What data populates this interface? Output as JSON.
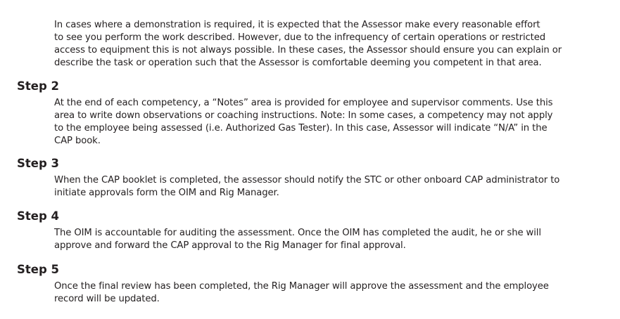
{
  "intro": {
    "lines": [
      "In cases where a demonstration is required, it is expected that the Assessor make every reasonable effort",
      "to see you perform the work described.  However, due to the infrequency of certain operations or restricted",
      "access to equipment this is not always possible.  In these cases, the Assessor should ensure you can explain or",
      "describe the task or operation such that the Assessor is comfortable deeming you competent in that area."
    ]
  },
  "steps": [
    {
      "heading": "Step 2",
      "lines": [
        "At the end of each competency, a “Notes” area is provided for employee and supervisor comments. Use this",
        "area to write down observations or coaching instructions. Note: In some cases, a competency may not apply",
        "to the employee being assessed (i.e. Authorized Gas Tester). In this case, Assessor will indicate “N/A” in the",
        "CAP book."
      ]
    },
    {
      "heading": "Step 3",
      "lines": [
        "When the CAP booklet is completed, the assessor should notify the STC or other onboard CAP administrator to",
        "initiate approvals form the OIM and Rig Manager."
      ]
    },
    {
      "heading": "Step 4",
      "lines": [
        "The OIM is accountable for auditing the assessment. Once the OIM has completed the audit, he or she will",
        "approve and forward the CAP approval to the Rig Manager for final approval."
      ]
    },
    {
      "heading": "Step 5",
      "lines": [
        "Once the final review has been completed, the Rig Manager will approve the assessment and the employee",
        "record will be updated."
      ]
    }
  ]
}
